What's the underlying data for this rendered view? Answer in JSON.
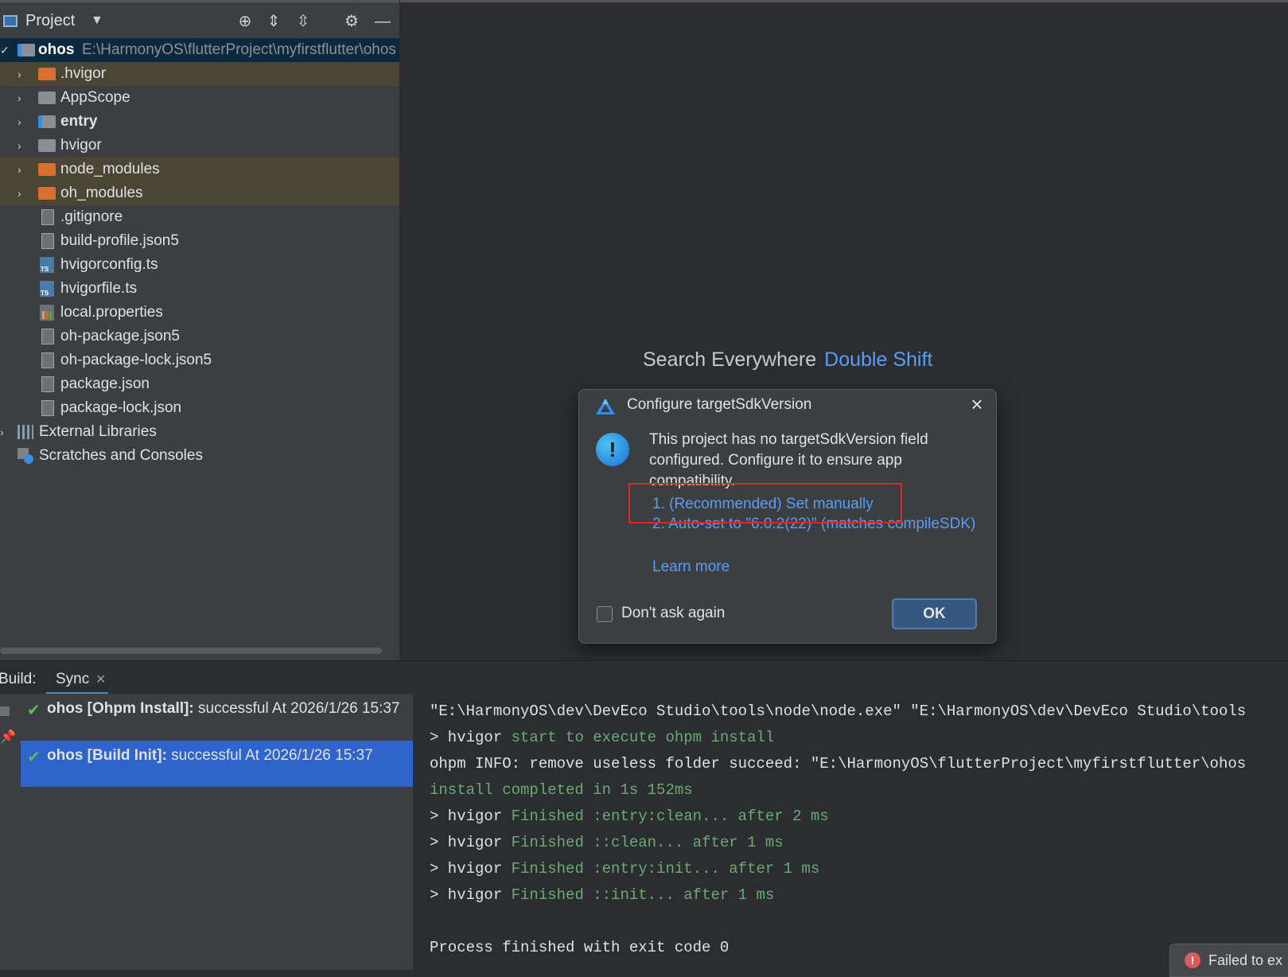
{
  "project_panel": {
    "title": "Project",
    "tools": [
      "locate-icon",
      "expand-all-icon",
      "collapse-all-icon",
      "gear-icon",
      "minimize-icon"
    ],
    "root": {
      "name": "ohos",
      "path": "E:\\HarmonyOS\\flutterProject\\myfirstflutter\\ohos"
    },
    "items": [
      {
        "label": ".hvigor",
        "icon": "folder-orange",
        "expandable": true,
        "excluded": true
      },
      {
        "label": "AppScope",
        "icon": "folder",
        "expandable": true
      },
      {
        "label": "entry",
        "icon": "module-folder",
        "expandable": true,
        "bold": true
      },
      {
        "label": "hvigor",
        "icon": "folder",
        "expandable": true
      },
      {
        "label": "node_modules",
        "icon": "folder-orange",
        "expandable": true,
        "excluded": true
      },
      {
        "label": "oh_modules",
        "icon": "folder-orange",
        "expandable": true,
        "excluded": true
      },
      {
        "label": ".gitignore",
        "icon": "file"
      },
      {
        "label": "build-profile.json5",
        "icon": "file"
      },
      {
        "label": "hvigorconfig.ts",
        "icon": "ts-file"
      },
      {
        "label": "hvigorfile.ts",
        "icon": "ts-file"
      },
      {
        "label": "local.properties",
        "icon": "properties-file"
      },
      {
        "label": "oh-package.json5",
        "icon": "file"
      },
      {
        "label": "oh-package-lock.json5",
        "icon": "file"
      },
      {
        "label": "package.json",
        "icon": "file"
      },
      {
        "label": "package-lock.json",
        "icon": "file"
      }
    ],
    "external_libraries": "External Libraries",
    "scratches": "Scratches and Consoles"
  },
  "editor": {
    "search_hint": "Search Everywhere",
    "search_key": "Double Shift"
  },
  "dialog": {
    "title": "Configure targetSdkVersion",
    "message": "This project has no targetSdkVersion field configured. Configure it to ensure app compatibility.",
    "option1": "1. (Recommended) Set manually",
    "option2": "2. Auto-set to \"6.0.2(22)\" (matches compileSDK)",
    "learn_more": "Learn more",
    "checkbox_label": "Don't ask again",
    "ok_label": "OK",
    "highlight_color": "#e0252b"
  },
  "build": {
    "label": "Build:",
    "tab": "Sync",
    "items": [
      {
        "bold": "ohos [Ohpm Install]:",
        "text": " successful At 2026/1/26 15:37",
        "selected": false
      },
      {
        "bold": "ohos [Build Init]:",
        "text": " successful At 2026/1/26 15:37",
        "selected": true
      }
    ],
    "console": {
      "l1": "\"E:\\HarmonyOS\\dev\\DevEco Studio\\tools\\node\\node.exe\" \"E:\\HarmonyOS\\dev\\DevEco Studio\\tools",
      "l2a": "> hvigor ",
      "l2b": "start to execute ohpm install",
      "l3": "ohpm INFO: remove useless folder succeed: \"E:\\HarmonyOS\\flutterProject\\myfirstflutter\\ohos",
      "l4": "install completed in 1s 152ms",
      "l5a": "> hvigor ",
      "l5b": "Finished :entry:clean... after 2 ms",
      "l6a": "> hvigor ",
      "l6b": "Finished ::clean... after 1 ms",
      "l7a": "> hvigor ",
      "l7b": "Finished :entry:init... after 1 ms",
      "l8a": "> hvigor ",
      "l8b": "Finished ::init... after 1 ms",
      "l9": "Process finished with exit code 0"
    },
    "toast": "Failed to ex"
  }
}
